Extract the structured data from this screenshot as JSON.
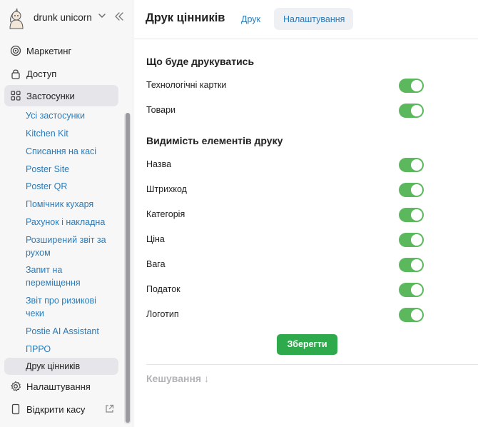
{
  "sidebar": {
    "account_name": "drunk unicorn",
    "nav": [
      {
        "label": "Маркетинг",
        "icon": "target-icon"
      },
      {
        "label": "Доступ",
        "icon": "lock-icon"
      },
      {
        "label": "Застосунки",
        "icon": "apps-grid-icon",
        "active": true
      },
      {
        "label": "Налаштування",
        "icon": "gear-icon"
      },
      {
        "label": "Відкрити касу",
        "icon": "tablet-icon"
      }
    ],
    "apps": [
      "Усі застосунки",
      "Kitchen Kit",
      "Списання на касі",
      "Poster Site",
      "Poster QR",
      "Помічник кухаря",
      "Рахунок і накладна",
      "Розширений звіт за рухом",
      "Запит на переміщення",
      "Звіт про ризикові чеки",
      "Postie AI Assistant",
      "ПРРО",
      "Друк цінників"
    ],
    "active_app_index": 12
  },
  "header": {
    "title": "Друк цінників",
    "tabs": [
      {
        "label": "Друк",
        "active": false
      },
      {
        "label": "Налаштування",
        "active": true
      }
    ]
  },
  "print_what": {
    "title": "Що буде друкуватись",
    "items": [
      {
        "label": "Технологічні картки",
        "enabled": true
      },
      {
        "label": "Товари",
        "enabled": true
      }
    ]
  },
  "visibility": {
    "title": "Видимість елементів друку",
    "items": [
      {
        "label": "Назва",
        "enabled": true
      },
      {
        "label": "Штрихкод",
        "enabled": true
      },
      {
        "label": "Категорія",
        "enabled": true
      },
      {
        "label": "Ціна",
        "enabled": true
      },
      {
        "label": "Вага",
        "enabled": true
      },
      {
        "label": "Податок",
        "enabled": true
      },
      {
        "label": "Логотип",
        "enabled": true
      }
    ]
  },
  "save_label": "Зберегти",
  "cache_label": "Кешування ↓",
  "colors": {
    "accent_link": "#2b7bb9",
    "toggle_on": "#5cb85c",
    "save_button": "#2eaa4d"
  }
}
